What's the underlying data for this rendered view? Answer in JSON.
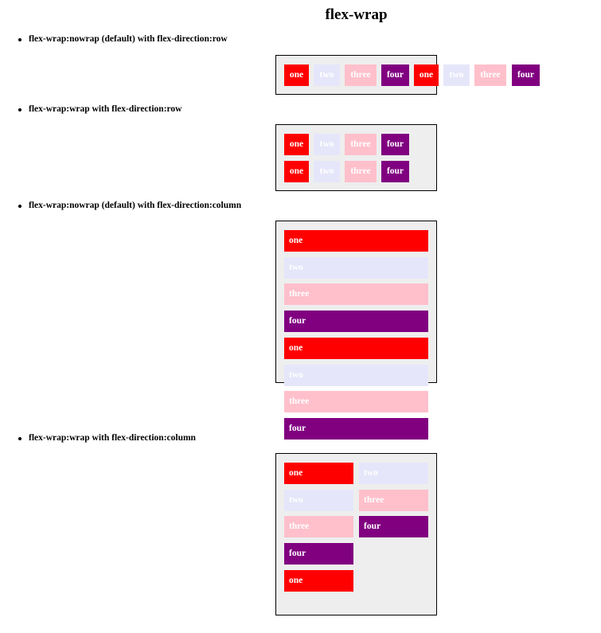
{
  "page": {
    "title": "flex-wrap"
  },
  "sections": [
    {
      "label": "flex-wrap:nowrap (default) with flex-direction:row",
      "items": [
        "one",
        "two",
        "three",
        "four",
        "one",
        "two",
        "three",
        "four"
      ]
    },
    {
      "label": "flex-wrap:wrap with flex-direction:row",
      "items": [
        "one",
        "two",
        "three",
        "four",
        "one",
        "two",
        "three",
        "four"
      ]
    },
    {
      "label": "flex-wrap:nowrap (default) with flex-direction:column",
      "items": [
        "one",
        "two",
        "three",
        "four",
        "one",
        "two",
        "three",
        "four"
      ]
    },
    {
      "label": "flex-wrap:wrap with flex-direction:column",
      "items": [
        "one",
        "two",
        "three",
        "four",
        "one",
        "two",
        "three",
        "four"
      ]
    }
  ],
  "colors": {
    "one": "#ff0000",
    "two": "#e6e6fa",
    "three": "#ffc0cb",
    "four": "#800080",
    "container_bg": "#eeeeee",
    "container_border": "#000000"
  }
}
